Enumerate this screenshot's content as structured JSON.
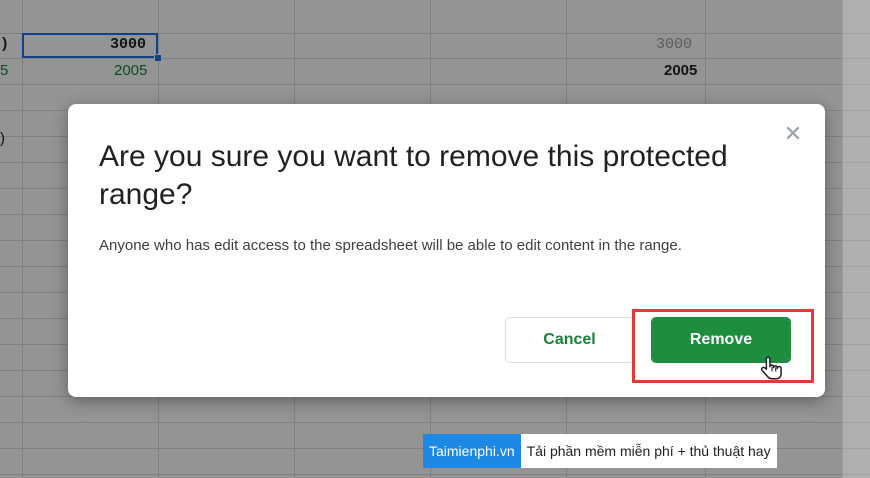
{
  "sheet": {
    "cells": {
      "row1_colB": "3000",
      "row1_colF": "3000",
      "row2_colB": "2005",
      "row2_colF": "2005",
      "row1_colA_partial": ")",
      "row2_colA_partial": "5",
      "row4_colA_partial": ")"
    },
    "selection_color": "#1a73e8"
  },
  "dialog": {
    "title": "Are you sure you want to remove this protected range?",
    "body": "Anyone who has edit access to the spreadsheet will be able to edit content in the range.",
    "close_icon": "close-icon",
    "cancel_label": "Cancel",
    "remove_label": "Remove",
    "accent_color": "#1e8e3e"
  },
  "annotation": {
    "highlight_color": "#e53935",
    "cursor_icon": "hand-pointer-icon"
  },
  "watermark": {
    "brand": "Taimienphi.vn",
    "tagline": "Tải phần mềm miễn phí + thủ thuật hay"
  }
}
